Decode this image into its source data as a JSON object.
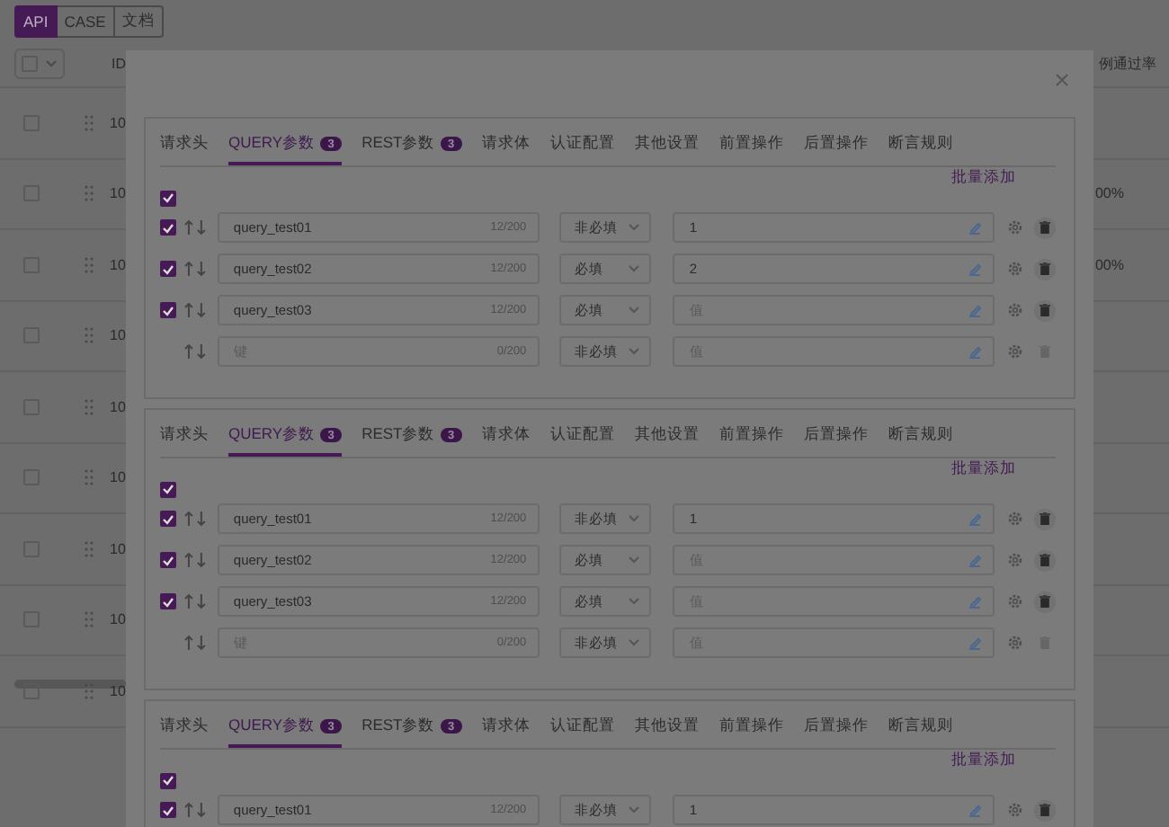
{
  "top_tabs": [
    {
      "label": "API",
      "selected": true
    },
    {
      "label": "CASE",
      "selected": false
    },
    {
      "label": "文档",
      "selected": false
    }
  ],
  "table": {
    "columns": [
      "ID",
      "例通过率"
    ],
    "rows": [
      {
        "checked": false,
        "id": "10"
      },
      {
        "checked": false,
        "id": "10",
        "rate": "00%"
      },
      {
        "checked": false,
        "id": "10",
        "rate": "00%"
      },
      {
        "checked": false,
        "id": "10"
      },
      {
        "checked": false,
        "id": "10"
      },
      {
        "checked": false,
        "id": "10"
      },
      {
        "checked": false,
        "id": "10"
      },
      {
        "checked": false,
        "id": "10"
      },
      {
        "checked": false,
        "id": "10"
      }
    ]
  },
  "modal": {
    "panels": [
      {
        "tabs": [
          {
            "label": "请求头",
            "selected": false
          },
          {
            "label": "QUERY参数",
            "badge": "3",
            "selected": true
          },
          {
            "label": "REST参数",
            "badge": "3",
            "selected": false
          },
          {
            "label": "请求体",
            "selected": false
          },
          {
            "label": "认证配置",
            "selected": false
          },
          {
            "label": "其他设置",
            "selected": false
          },
          {
            "label": "前置操作",
            "selected": false
          },
          {
            "label": "后置操作",
            "selected": false
          },
          {
            "label": "断言规则",
            "selected": false
          }
        ],
        "batch_add": "批量添加",
        "select_all_checked": true,
        "params": [
          {
            "kind": "param",
            "checked": true,
            "key": "query_test01",
            "counter": "12/200",
            "required": "非必填",
            "value": "1"
          },
          {
            "kind": "param",
            "checked": true,
            "key": "query_test02",
            "counter": "12/200",
            "required": "必填",
            "value": "2"
          },
          {
            "kind": "param",
            "checked": true,
            "key": "query_test03",
            "counter": "12/200",
            "required": "必填",
            "value_placeholder": "值"
          },
          {
            "kind": "new",
            "key_placeholder": "键",
            "counter": "0/200",
            "required": "非必填",
            "value_placeholder": "值"
          }
        ]
      },
      {
        "tabs": [
          {
            "label": "请求头",
            "selected": false
          },
          {
            "label": "QUERY参数",
            "badge": "3",
            "selected": true
          },
          {
            "label": "REST参数",
            "badge": "3",
            "selected": false
          },
          {
            "label": "请求体",
            "selected": false
          },
          {
            "label": "认证配置",
            "selected": false
          },
          {
            "label": "其他设置",
            "selected": false
          },
          {
            "label": "前置操作",
            "selected": false
          },
          {
            "label": "后置操作",
            "selected": false
          },
          {
            "label": "断言规则",
            "selected": false
          }
        ],
        "batch_add": "批量添加",
        "select_all_checked": true,
        "params": [
          {
            "kind": "param",
            "checked": true,
            "key": "query_test01",
            "counter": "12/200",
            "required": "非必填",
            "value": "1"
          },
          {
            "kind": "param",
            "checked": true,
            "key": "query_test02",
            "counter": "12/200",
            "required": "必填",
            "value_placeholder": "值"
          },
          {
            "kind": "param",
            "checked": true,
            "key": "query_test03",
            "counter": "12/200",
            "required": "必填",
            "value_placeholder": "值"
          },
          {
            "kind": "new",
            "key_placeholder": "键",
            "counter": "0/200",
            "required": "非必填",
            "value_placeholder": "值"
          }
        ]
      },
      {
        "tabs": [
          {
            "label": "请求头",
            "selected": false
          },
          {
            "label": "QUERY参数",
            "badge": "3",
            "selected": true
          },
          {
            "label": "REST参数",
            "badge": "3",
            "selected": false
          },
          {
            "label": "请求体",
            "selected": false
          },
          {
            "label": "认证配置",
            "selected": false
          },
          {
            "label": "其他设置",
            "selected": false
          },
          {
            "label": "前置操作",
            "selected": false
          },
          {
            "label": "后置操作",
            "selected": false
          },
          {
            "label": "断言规则",
            "selected": false
          }
        ],
        "batch_add": "批量添加",
        "select_all_checked": true,
        "params": [
          {
            "kind": "param",
            "checked": true,
            "key": "query_test01",
            "counter": "12/200",
            "required": "非必填",
            "value": "1"
          }
        ]
      }
    ]
  }
}
